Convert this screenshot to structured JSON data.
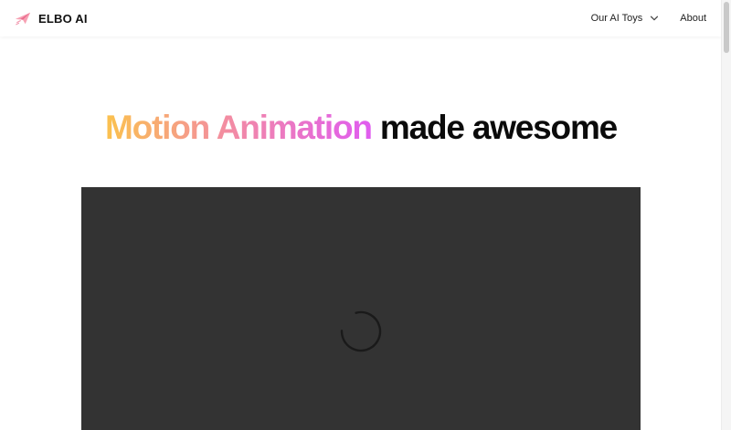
{
  "brand": {
    "name": "ELBO AI",
    "logo_icon": "paper-plane-logo-icon",
    "logo_colors": [
      "#f7a1b3",
      "#e96b8e"
    ]
  },
  "nav": {
    "items": [
      {
        "label": "Our AI Toys",
        "icon": "chevron-down-icon"
      },
      {
        "label": "About"
      }
    ]
  },
  "hero": {
    "title_highlight": "Motion Animation",
    "title_rest": "made awesome",
    "gradient_colors": [
      "#fbc24e",
      "#f38da1",
      "#e05cf0"
    ]
  },
  "video": {
    "state": "loading",
    "icon": "loading-spinner-icon",
    "background": "#333333"
  }
}
